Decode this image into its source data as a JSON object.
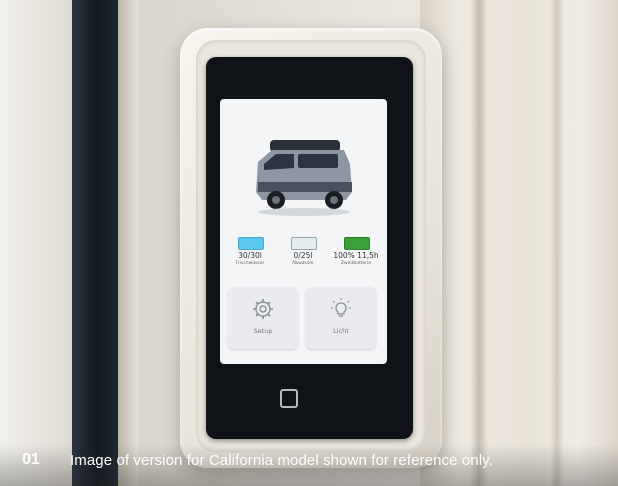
{
  "caption": {
    "number": "01",
    "text": "Image of version for California model shown for reference only."
  },
  "screen": {
    "tiles": [
      {
        "value": "30/30l",
        "label": "Frischwasser",
        "color": "#5bc8f0",
        "fill": 1.0
      },
      {
        "value": "0/25l",
        "label": "Abwasser",
        "color": "#e4eef0",
        "fill": 0.0
      },
      {
        "value": "100% 11,5h",
        "label": "Zweitbatterie",
        "color": "#3aa13a",
        "fill": 1.0
      }
    ],
    "buttons": [
      {
        "label": "Setup",
        "icon": "gear-icon"
      },
      {
        "label": "Licht",
        "icon": "lightbulb-icon"
      }
    ]
  },
  "colors": {
    "device": "#0f1216",
    "screen": "#f4f5f7",
    "van_body": "#8d96a3",
    "van_roof": "#2b3038"
  }
}
